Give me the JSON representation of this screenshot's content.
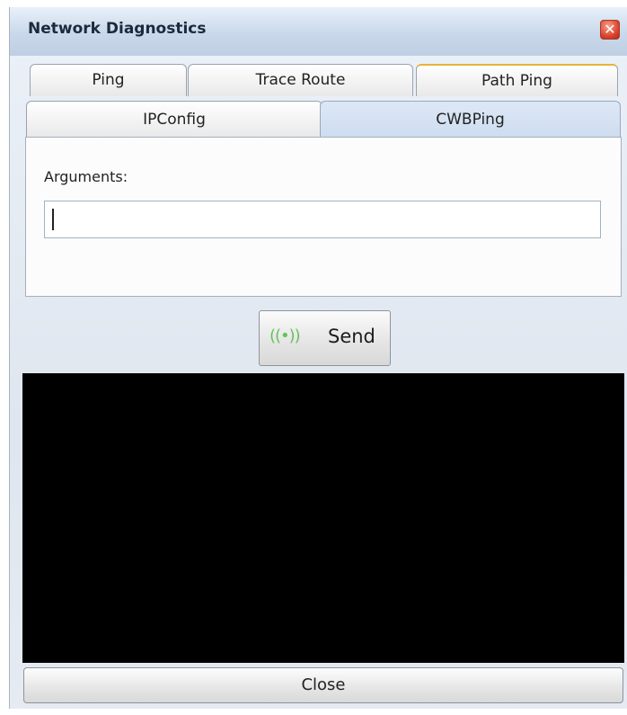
{
  "window": {
    "title": "Network Diagnostics",
    "close_glyph": "✕"
  },
  "tabs": [
    {
      "label": "Ping",
      "selected": false
    },
    {
      "label": "Trace Route",
      "selected": false
    },
    {
      "label": "Path Ping",
      "selected": false
    },
    {
      "label": "IPConfig",
      "selected": false
    },
    {
      "label": "CWBPing",
      "selected": true
    }
  ],
  "panel": {
    "arguments_label": "Arguments:",
    "arguments_value": ""
  },
  "send_button": {
    "label": "Send",
    "icon": "signal-broadcast-icon",
    "icon_glyph": "((•))",
    "icon_color": "#66c25a"
  },
  "console": {
    "output": "",
    "background": "#000000"
  },
  "footer": {
    "close_label": "Close"
  }
}
